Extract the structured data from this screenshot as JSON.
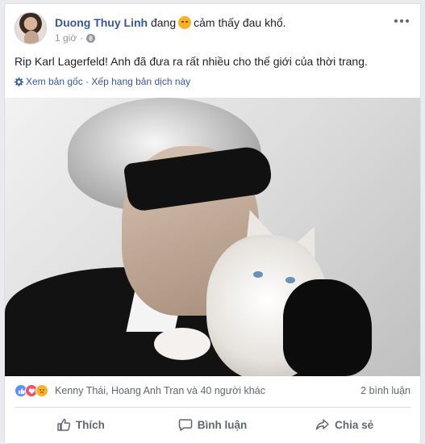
{
  "post": {
    "author": "Duong Thuy Linh",
    "feeling_prefix": "đang",
    "feeling_text": "cảm thấy đau khổ.",
    "timestamp": "1 giờ",
    "text": "Rip Karl Lagerfeld! Anh đã đưa ra rất nhiều cho thế giới của thời trang.",
    "translation": {
      "see_original": "Xem bản gốc",
      "separator": "·",
      "rate_translation": "Xếp hạng bản dịch này"
    }
  },
  "reactions": {
    "names": "Kenny Thái, Hoang Anh Tran và 40 người khác",
    "comments": "2 bình luận",
    "icons": [
      "like-icon",
      "love-icon",
      "sad-icon"
    ]
  },
  "actions": {
    "like": "Thích",
    "comment": "Bình luận",
    "share": "Chia sẻ"
  },
  "colors": {
    "link": "#365899",
    "meta": "#90949c",
    "action": "#606770"
  }
}
